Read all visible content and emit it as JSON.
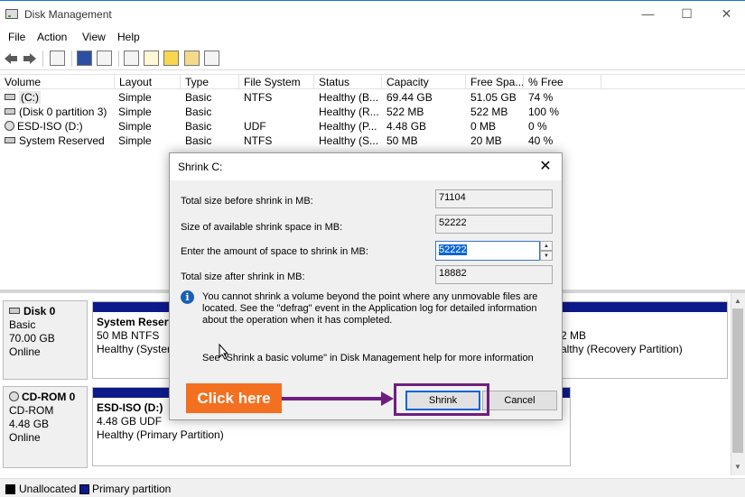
{
  "window": {
    "title": "Disk Management"
  },
  "menu": [
    "File",
    "Action",
    "View",
    "Help"
  ],
  "volume_table": {
    "columns": [
      "Volume",
      "Layout",
      "Type",
      "File System",
      "Status",
      "Capacity",
      "Free Spa...",
      "% Free"
    ],
    "rows": [
      [
        "(C:)",
        "Simple",
        "Basic",
        "NTFS",
        "Healthy (B...",
        "69.44 GB",
        "51.05 GB",
        "74 %"
      ],
      [
        "(Disk 0 partition 3)",
        "Simple",
        "Basic",
        "",
        "Healthy (R...",
        "522 MB",
        "522 MB",
        "100 %"
      ],
      [
        "ESD-ISO (D:)",
        "Simple",
        "Basic",
        "UDF",
        "Healthy (P...",
        "4.48 GB",
        "0 MB",
        "0 %"
      ],
      [
        "System Reserved",
        "Simple",
        "Basic",
        "NTFS",
        "Healthy (S...",
        "50 MB",
        "20 MB",
        "40 %"
      ]
    ]
  },
  "disks": [
    {
      "name": "Disk 0",
      "kind": "Basic",
      "size": "70.00 GB",
      "state": "Online",
      "partitions": [
        {
          "name": "System Reserv",
          "detail": "50 MB NTFS",
          "status": "Healthy (System"
        },
        {
          "name": "",
          "detail": "2 MB",
          "status": "althy (Recovery Partition)"
        }
      ]
    },
    {
      "name": "CD-ROM 0",
      "kind": "CD-ROM",
      "size": "4.48 GB",
      "state": "Online",
      "partitions": [
        {
          "name": "ESD-ISO  (D:)",
          "detail": "4.48 GB UDF",
          "status": "Healthy (Primary Partition)"
        }
      ]
    }
  ],
  "legend": [
    {
      "label": "Unallocated",
      "color": "#000000"
    },
    {
      "label": "Primary partition",
      "color": "#0d1a8a"
    }
  ],
  "dialog": {
    "title": "Shrink C:",
    "total_before_label": "Total size before shrink in MB:",
    "total_before_value": "71104",
    "available_label": "Size of available shrink space in MB:",
    "available_value": "52222",
    "amount_label": "Enter the amount of space to shrink in MB:",
    "amount_value": "52222",
    "total_after_label": "Total size after shrink in MB:",
    "total_after_value": "18882",
    "info": "You cannot shrink a volume beyond the point where any unmovable files are located. See the \"defrag\" event in the Application log for detailed information about the operation when it has completed.",
    "help": "See \"Shrink a basic volume\" in Disk Management help for more information",
    "shrink_label": "Shrink",
    "cancel_label": "Cancel"
  },
  "annotation": {
    "callout": "Click here",
    "color": "#f37021",
    "arrow_color": "#6f1e7f"
  }
}
